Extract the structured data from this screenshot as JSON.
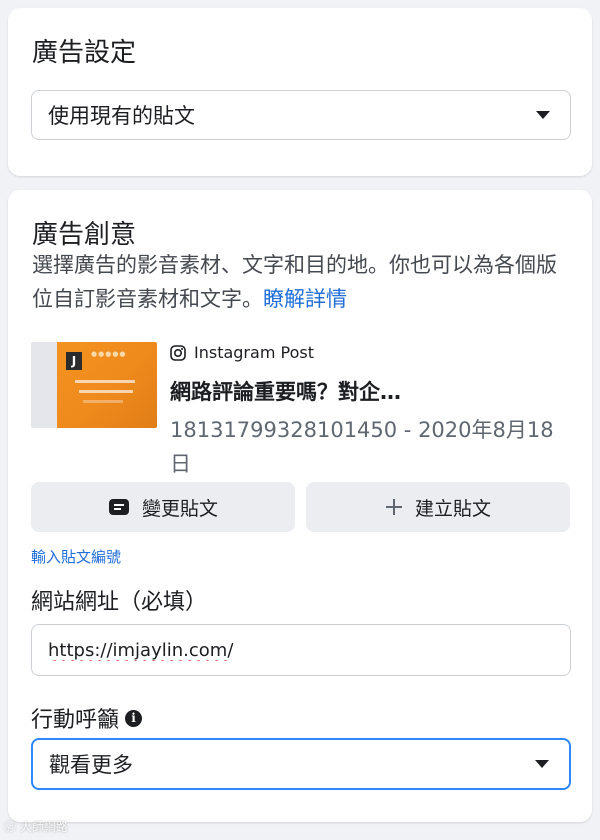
{
  "ad_settings": {
    "title": "廣告設定",
    "post_source_select": {
      "value": "使用現有的貼文"
    }
  },
  "ad_creative": {
    "title": "廣告創意",
    "description": "選擇廣告的影音素材、文字和目的地。你也可以為各個版位自訂影音素材和文字。",
    "learn_more_link": "瞭解詳情",
    "post": {
      "platform_icon": "instagram-icon",
      "source": "Instagram Post",
      "title": "網路評論重要嗎？對企…",
      "meta": "18131799328101450 - 2020年8月18日"
    },
    "change_post_button": {
      "label": "變更貼文",
      "icon": "message-icon"
    },
    "create_post_button": {
      "label": "建立貼文",
      "icon": "plus-icon"
    },
    "enter_post_id_link": "輸入貼文編號",
    "website_url": {
      "label": "網站網址（必填）",
      "value": "https://imjaylin.com/"
    },
    "call_to_action": {
      "label": "行動呼籲",
      "info_icon": "info-icon",
      "value": "觀看更多"
    }
  },
  "colors": {
    "link": "#216fdb",
    "focus_border": "#2d88ff",
    "page_background": "#f0f2f5",
    "thumbnail_orange": "#f39221"
  }
}
